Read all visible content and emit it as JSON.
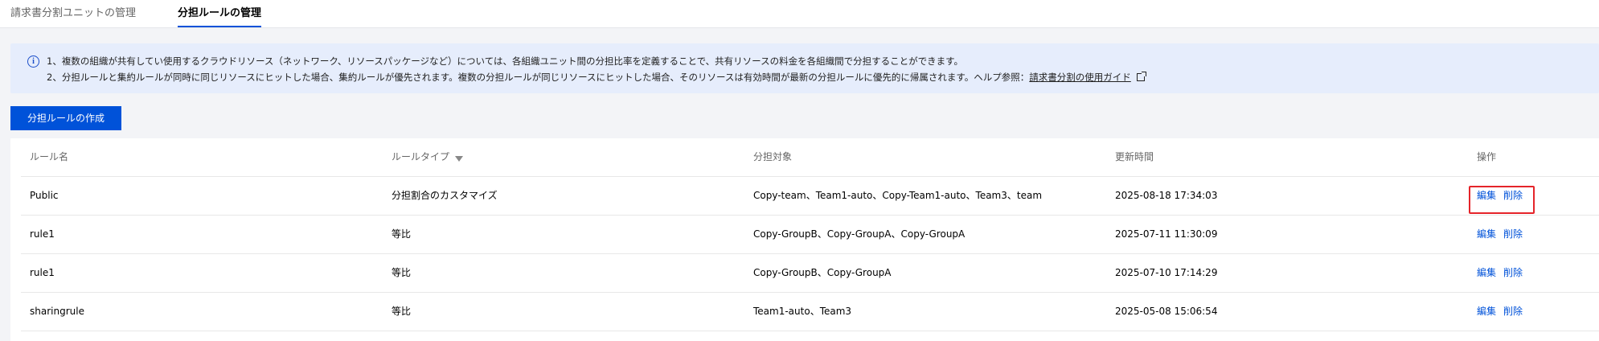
{
  "tabs": [
    {
      "label": "請求書分割ユニットの管理",
      "active": false
    },
    {
      "label": "分担ルールの管理",
      "active": true
    }
  ],
  "notice": {
    "line1": "1、複数の組織が共有してい使用するクラウドリソース（ネットワーク、リソースパッケージなど）については、各組織ユニット間の分担比率を定義することで、共有リソースの料金を各組織間で分担することができます。",
    "line2_prefix": "2、分担ルールと集約ルールが同時に同じリソースにヒットした場合、集約ルールが優先されます。複数の分担ルールが同じリソースにヒットした場合、そのリソースは有効時間が最新の分担ルールに優先的に帰属されます。ヘルプ参照：",
    "help_link": "請求書分割の使用ガイド"
  },
  "create_button": "分担ルールの作成",
  "table": {
    "headers": [
      "ルール名",
      "ルールタイプ",
      "分担対象",
      "更新時間",
      "操作"
    ],
    "rows": [
      {
        "name": "Public",
        "type": "分担割合のカスタマイズ",
        "targets": "Copy-team、Team1-auto、Copy-Team1-auto、Team3、team",
        "updated": "2025-08-18 17:34:03",
        "edit": "編集",
        "delete": "削除"
      },
      {
        "name": "rule1",
        "type": "等比",
        "targets": "Copy-GroupB、Copy-GroupA、Copy-GroupA",
        "updated": "2025-07-11 11:30:09",
        "edit": "編集",
        "delete": "削除"
      },
      {
        "name": "rule1",
        "type": "等比",
        "targets": "Copy-GroupB、Copy-GroupA",
        "updated": "2025-07-10 17:14:29",
        "edit": "編集",
        "delete": "削除"
      },
      {
        "name": "sharingrule",
        "type": "等比",
        "targets": "Team1-auto、Team3",
        "updated": "2025-05-08 15:06:54",
        "edit": "編集",
        "delete": "削除"
      }
    ]
  },
  "colors": {
    "accent": "#0052d9",
    "highlight": "#e5242a",
    "notice_bg": "#e6edfc"
  }
}
